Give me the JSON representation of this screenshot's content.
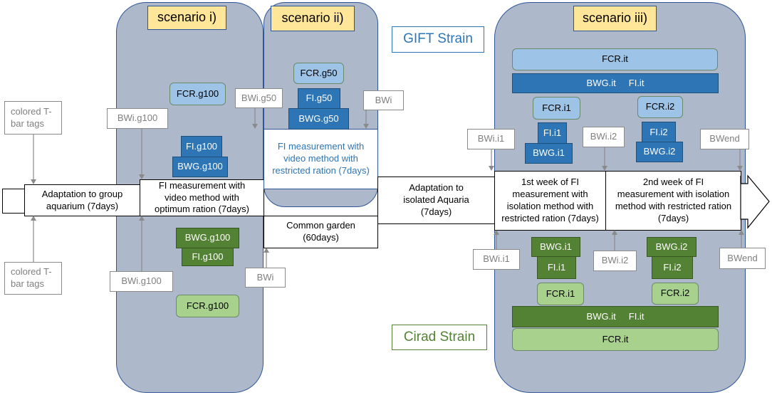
{
  "colors": {
    "panel": "#adb9ca",
    "panel_border": "#2f5597",
    "scenario_label": "#ffe699",
    "gift_blue": "#2e75b6",
    "gift_light": "#9dc3e6",
    "cirad_green": "#548235",
    "cirad_light": "#a9d18e"
  },
  "scenarios": {
    "i": "scenario i)",
    "ii": "scenario ii)",
    "iii": "scenario iii)"
  },
  "strains": {
    "gift": "GIFT Strain",
    "cirad": "Cirad Strain"
  },
  "flow": {
    "adapt_group": "Adaptation to group aquarium (7days)",
    "fi_optimum": "FI measurement with video method with optimum ration (7days)",
    "fi_restricted": "FI measurement with video method with restricted ration (7days)",
    "common_garden": "Common garden (60days)",
    "adapt_isolated": "Adaptation to isolated Aquaria (7days)",
    "week1": "1st week of FI measurement with isolation method with restricted ration (7days)",
    "week2": "2nd week of FI measurement with isolation method with restricted ration (7days)"
  },
  "tags": {
    "top": "colored T-bar tags",
    "bottom": "colored T-bar tags"
  },
  "weights": {
    "bwi_g100": "BWi.g100",
    "bwi_g50": "BWi.g50",
    "bwi": "BWi",
    "bwi_i1": "BWi.i1",
    "bwi_i2": "BWi.i2",
    "bwend": "BWend"
  },
  "gift": {
    "fcr_g100": "FCR.g100",
    "fi_g100": "FI.g100",
    "bwg_g100": "BWG.g100",
    "fcr_g50": "FCR.g50",
    "fi_g50": "FI.g50",
    "bwg_g50": "BWG.g50",
    "fcr_it": "FCR.it",
    "bwg_fi_it": "BWG.it     FI.it",
    "fcr_i1": "FCR.i1",
    "fi_i1": "FI.i1",
    "bwg_i1": "BWG.i1",
    "fcr_i2": "FCR.i2",
    "fi_i2": "FI.i2",
    "bwg_i2": "BWG.i2"
  },
  "cirad": {
    "bwg_g100": "BWG.g100",
    "fi_g100": "FI.g100",
    "fcr_g100": "FCR.g100",
    "bwg_i1": "BWG.i1",
    "fi_i1": "FI.i1",
    "fcr_i1": "FCR.i1",
    "bwg_i2": "BWG.i2",
    "fi_i2": "FI.i2",
    "fcr_i2": "FCR.i2",
    "bwg_fi_it": "BWG.it     FI.it",
    "fcr_it": "FCR.it"
  }
}
